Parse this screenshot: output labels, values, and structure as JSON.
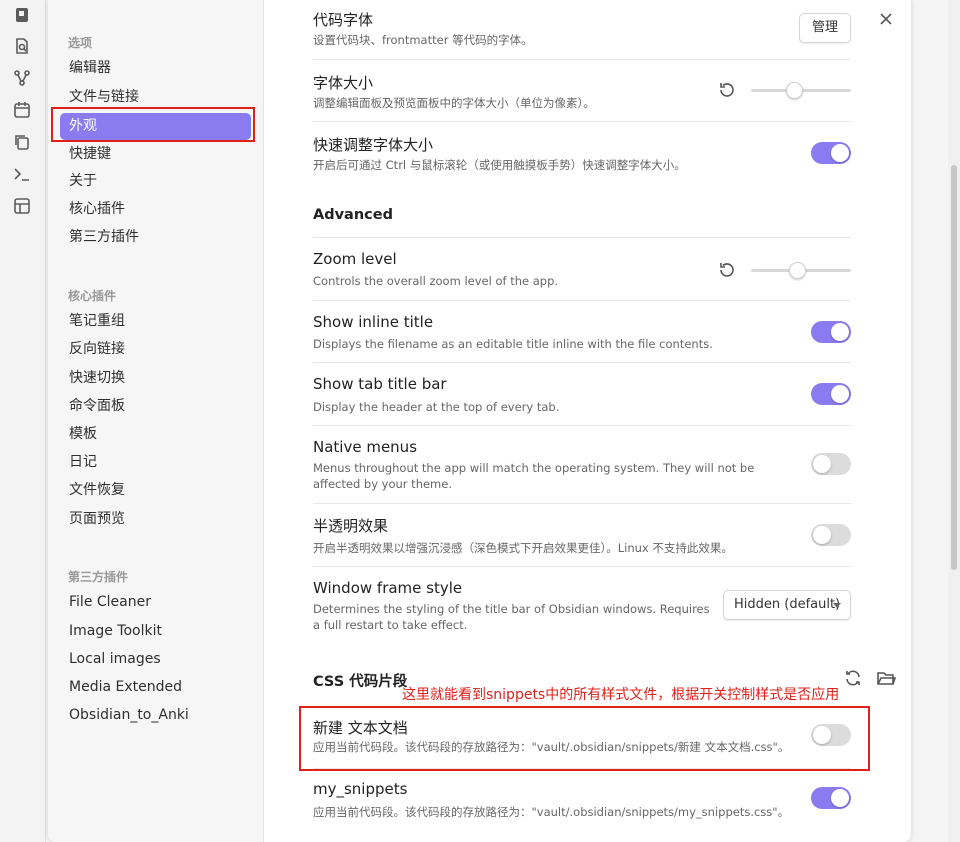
{
  "ribbon": {
    "icons": [
      "note-icon",
      "search-file-icon",
      "graph-icon",
      "calendar-icon",
      "copy-icon",
      "terminal-icon",
      "layout-icon"
    ]
  },
  "sidebar": {
    "options_header": "选项",
    "options": [
      "编辑器",
      "文件与链接",
      "外观",
      "快捷键",
      "关于",
      "核心插件",
      "第三方插件"
    ],
    "active": "外观",
    "core_header": "核心插件",
    "core_plugins": [
      "笔记重组",
      "反向链接",
      "快速切换",
      "命令面板",
      "模板",
      "日记",
      "文件恢复",
      "页面预览"
    ],
    "community_header": "第三方插件",
    "community_plugins": [
      "File Cleaner",
      "Image Toolkit",
      "Local images",
      "Media Extended",
      "Obsidian_to_Anki"
    ]
  },
  "settings": {
    "code_font": {
      "title": "代码字体",
      "desc": "设置代码块、frontmatter 等代码的字体。",
      "button": "管理"
    },
    "font_size": {
      "title": "字体大小",
      "desc": "调整编辑面板及预览面板中的字体大小（单位为像素）。",
      "value": 0.42
    },
    "quick_font": {
      "title": "快速调整字体大小",
      "desc": "开启后可通过 Ctrl 与鼠标滚轮（或使用触摸板手势）快速调整字体大小。",
      "on": true
    },
    "advanced_header": "Advanced",
    "zoom": {
      "title": "Zoom level",
      "desc": "Controls the overall zoom level of the app.",
      "value": 0.46
    },
    "inline_title": {
      "title": "Show inline title",
      "desc": "Displays the filename as an editable title inline with the file contents.",
      "on": true
    },
    "tab_title": {
      "title": "Show tab title bar",
      "desc": "Display the header at the top of every tab.",
      "on": true
    },
    "native_menus": {
      "title": "Native menus",
      "desc": "Menus throughout the app will match the operating system. They will not be affected by your theme.",
      "on": false
    },
    "translucent": {
      "title": "半透明效果",
      "desc": "开启半透明效果以增强沉浸感（深色模式下开启效果更佳）。Linux 不支持此效果。",
      "on": false
    },
    "window_frame": {
      "title": "Window frame style",
      "desc": "Determines the styling of the title bar of Obsidian windows. Requires a full restart to take effect.",
      "selected": "Hidden (default)"
    },
    "css_header": "CSS 代码片段",
    "snippets": [
      {
        "title": "新建 文本文档",
        "desc": "应用当前代码段。该代码段的存放路径为：\"vault/.obsidian/snippets/新建 文本文档.css\"。",
        "on": false
      },
      {
        "title": "my_snippets",
        "desc": "应用当前代码段。该代码段的存放路径为：\"vault/.obsidian/snippets/my_snippets.css\"。",
        "on": true
      }
    ]
  },
  "annotation": "这里就能看到snippets中的所有样式文件，根据开关控制样式是否应用",
  "colors": {
    "accent": "#8a7cf0",
    "highlight": "#e0201b"
  }
}
